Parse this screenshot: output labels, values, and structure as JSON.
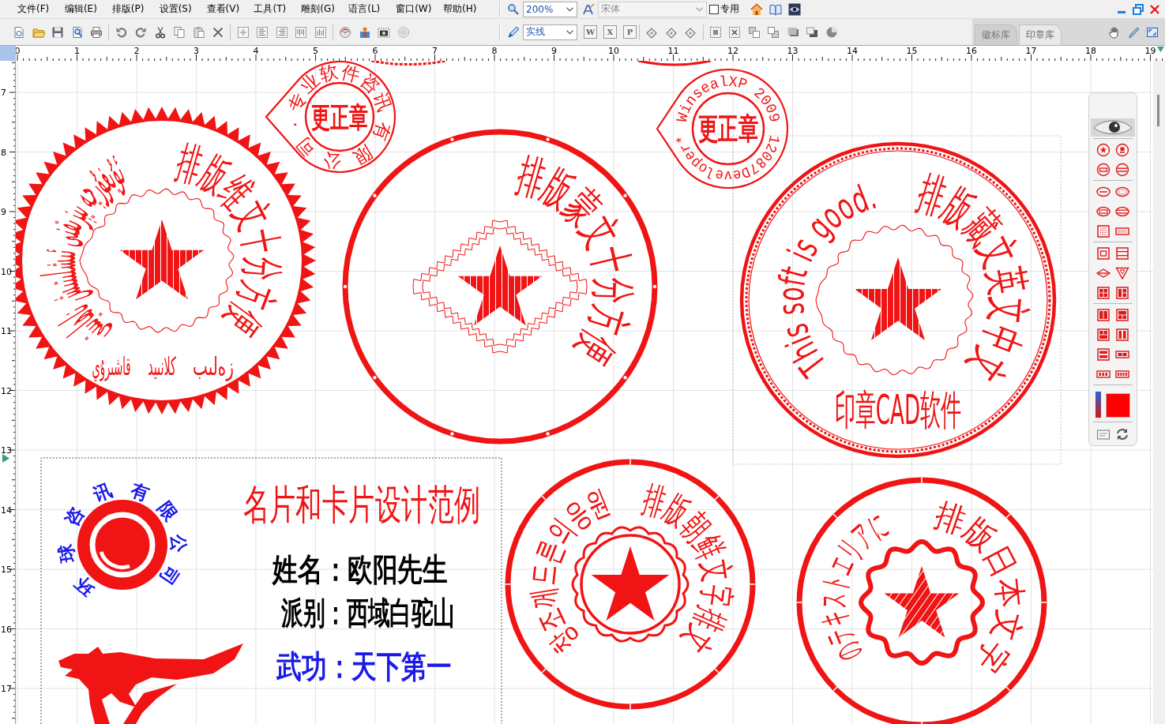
{
  "menu": [
    "文件(F)",
    "编辑(E)",
    "排版(P)",
    "设置(S)",
    "查看(V)",
    "工具(T)",
    "雕刻(G)",
    "语言(L)",
    "窗口(W)",
    "帮助(H)"
  ],
  "toolbar": {
    "zoom": "200%",
    "font": {
      "value": "宋体",
      "disabled": true
    },
    "exclusive": {
      "label": "专用",
      "checked": false
    },
    "line_style": "实线",
    "export_buttons": [
      "W",
      "X",
      "P"
    ]
  },
  "library_tabs": [
    {
      "label": "徽标库",
      "selected": false
    },
    {
      "label": "印章库",
      "selected": true
    }
  ],
  "rulers": {
    "horizontal": [
      "0",
      "1",
      "2",
      "3",
      "4",
      "5",
      "6",
      "7",
      "8",
      "9",
      "10",
      "11",
      "12",
      "13",
      "14",
      "15",
      "16",
      "17",
      "18",
      "19"
    ],
    "vertical": [
      "7",
      "8",
      "9",
      "10",
      "11",
      "12",
      "13",
      "14",
      "15",
      "16",
      "17"
    ]
  },
  "stamps": [
    {
      "kind": "serrated",
      "ring_texts": [
        "ئۇيغۇرچە يېزىقنى ئىشلىتىش ناھايىتى",
        "排版维文十分方便"
      ],
      "bottom_texts": [
        "زەلىب",
        "كلانىيد",
        "قاشىرۇي"
      ]
    },
    {
      "kind": "heart",
      "ring_texts": [
        "专业软件咨讯",
        "有限公司·"
      ],
      "center_text": "更正章"
    },
    {
      "kind": "dotted_ring",
      "ring_texts": [
        "排版蒙文十分方便"
      ]
    },
    {
      "kind": "heart",
      "ring_texts": [
        "WinsealXP 2009",
        "12087Developer*"
      ],
      "center_text": "更正章"
    },
    {
      "kind": "double_ring",
      "ring_texts": [
        "This soft is good.",
        "排版藏文英文中文"
      ],
      "bottom_texts": [
        "印章CAD软件"
      ]
    },
    {
      "kind": "ticked_ring",
      "ring_texts": [
        "창조께드른의응원",
        "排版朝鲜文字排文"
      ]
    },
    {
      "kind": "ticked_ring",
      "ring_texts": [
        "のテキストエリアに",
        "排版日本文字"
      ]
    }
  ],
  "card": {
    "logo_texts": [
      "环球咨讯",
      "有限公司"
    ],
    "title": "名片和卡片设计范例",
    "lines": [
      {
        "text": "姓名：欧阳先生",
        "color": "#000000"
      },
      {
        "text": "派别：西域白驼山",
        "color": "#000000"
      },
      {
        "text": "武功：天下第一",
        "color": "#1a1ae6"
      }
    ]
  },
  "palette": {
    "color": "#ff0000"
  }
}
